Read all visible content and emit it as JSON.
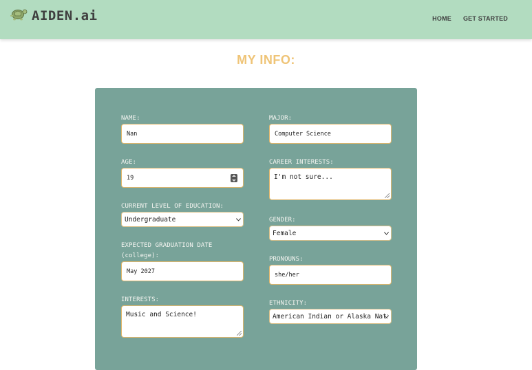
{
  "header": {
    "brand": "AIDEN.ai",
    "logo_icon": "turtle-icon",
    "nav": {
      "home": "HOME",
      "get_started": "GET STARTED"
    }
  },
  "page": {
    "title": "MY INFO:"
  },
  "colors": {
    "navbar": "#b2dcc0",
    "title": "#efc477",
    "card": "#78a399",
    "input_border": "#e0b66a"
  },
  "form": {
    "name": {
      "label": "NAME:",
      "value": "Nan"
    },
    "age": {
      "label": "AGE:",
      "value": "19"
    },
    "education": {
      "label": "CURRENT LEVEL OF EDUCATION:",
      "value": "Undergraduate"
    },
    "graduation": {
      "label_line1": "EXPECTED GRADUATION DATE",
      "label_line2": "(college):",
      "value": "May 2027"
    },
    "interests": {
      "label": "INTERESTS:",
      "value": "Music and Science!"
    },
    "major": {
      "label": "MAJOR:",
      "value": "Computer Science"
    },
    "career": {
      "label": "CAREER INTERESTS:",
      "value": "I'm not sure..."
    },
    "gender": {
      "label": "GENDER:",
      "value": "Female"
    },
    "pronouns": {
      "label": "PRONOUNS:",
      "value": "she/her"
    },
    "ethnicity": {
      "label": "ETHNICITY:",
      "value": "American Indian or Alaska Native"
    }
  }
}
